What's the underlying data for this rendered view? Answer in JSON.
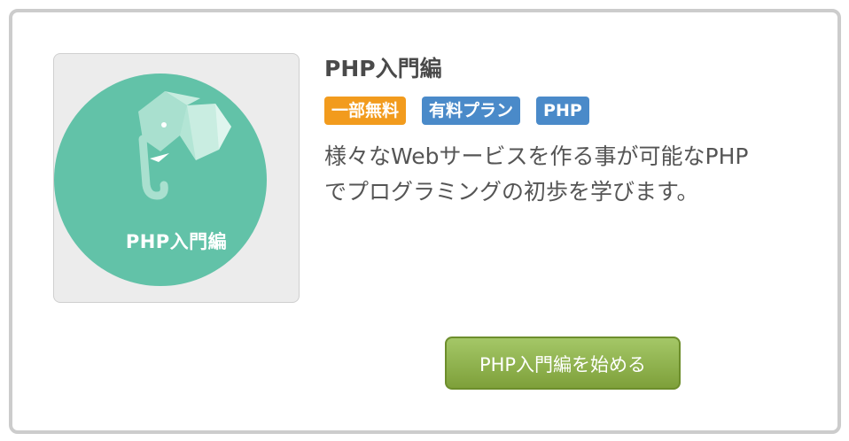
{
  "course": {
    "title": "PHP入門編",
    "thumbnail_caption": "PHP入門編",
    "badges": [
      {
        "label": "一部無料",
        "color": "#f29b1d"
      },
      {
        "label": "有料プラン",
        "color": "#4a8ac9"
      },
      {
        "label": "PHP",
        "color": "#4a8ac9"
      }
    ],
    "description_lines": [
      "様々なWebサービスを作る事が可能なPHP",
      "でプログラミングの初歩を学びます。"
    ],
    "start_button_label": "PHP入門編を始める"
  },
  "colors": {
    "thumbnail_circle": "#62c2a8",
    "button": "#8db04a",
    "card_border": "#cccccc"
  },
  "icons": {
    "thumbnail": "elephant-icon"
  }
}
